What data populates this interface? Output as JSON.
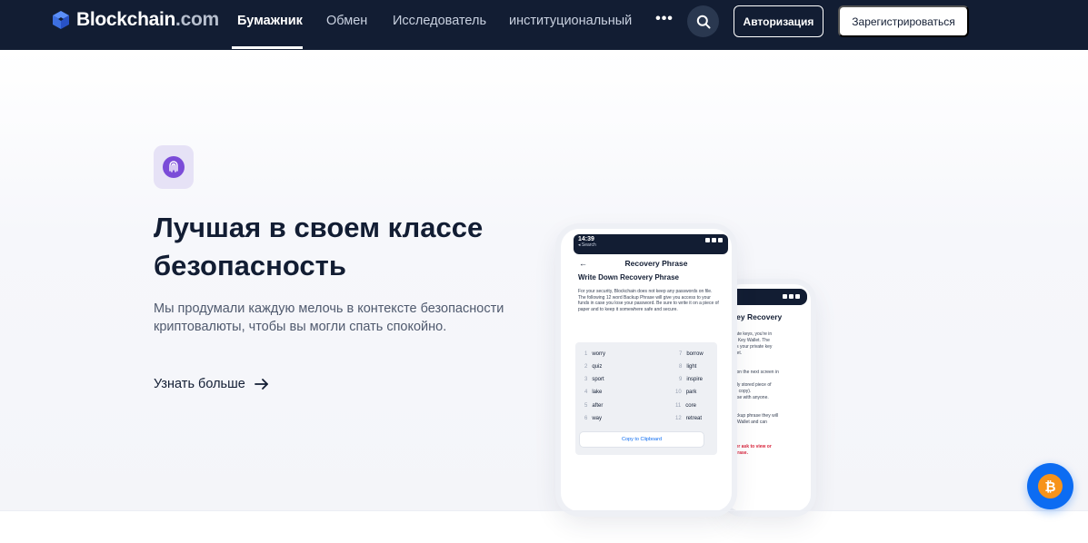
{
  "header": {
    "logo_brand": "Blockchain",
    "logo_suffix": ".com",
    "nav": [
      "Бумажник",
      "Обмен",
      "Исследователь",
      "институциональный"
    ],
    "more_label": "•••",
    "login_label": "Авторизация",
    "signup_label": "Зарегистрироваться"
  },
  "hero": {
    "title": "Лучшая в своем классе безопасность",
    "subtitle": "Мы продумали каждую мелочь в контексте безопасности криптовалюты, чтобы вы могли спать спокойно.",
    "learn_more": "Узнать больше"
  },
  "phone_front": {
    "time": "14:39",
    "back_link": "◂ Search",
    "header_title": "Recovery Phrase",
    "subtitle": "Write Down Recovery Phrase",
    "body": "For your security, Blockchain does not keep any passwords on file. The following 12 word Backup Phrase will give you access to your funds in case you lose your password. Be sure to write it on a piece of paper and to keep it somewhere safe and secure.",
    "words": [
      {
        "n": "1",
        "w": "worry"
      },
      {
        "n": "2",
        "w": "quiz"
      },
      {
        "n": "3",
        "w": "sport"
      },
      {
        "n": "4",
        "w": "lake"
      },
      {
        "n": "5",
        "w": "after"
      },
      {
        "n": "6",
        "w": "way"
      },
      {
        "n": "7",
        "w": "borrow"
      },
      {
        "n": "8",
        "w": "light"
      },
      {
        "n": "9",
        "w": "inspire"
      },
      {
        "n": "10",
        "w": "park"
      },
      {
        "n": "11",
        "w": "core"
      },
      {
        "n": "12",
        "w": "retreat"
      }
    ],
    "copy_label": "Copy to Clipboard"
  },
  "phone_back": {
    "title": "Key Recovery",
    "lines": [
      "private keys, you're in",
      "vate Key Wallet. The",
      "vides your private key",
      "Wallet.",
      "ase on the next screen in",
      "curely stored piece of",
      "igital copy).",
      "phrase with anyone.",
      "r backup phrase they will",
      "Key Wallet and can"
    ],
    "warning_lines": [
      "never ask to view or",
      "y phrase."
    ]
  },
  "colors": {
    "header_bg": "#121d33",
    "accent_blue": "#0c6cf2",
    "icon_purple": "#7b4cd8",
    "bitcoin_orange": "#f7931a"
  },
  "icons": {
    "search": "search-icon",
    "feature": "fingerprint-icon",
    "arrow": "arrow-right-icon",
    "fab": "bitcoin-icon"
  }
}
